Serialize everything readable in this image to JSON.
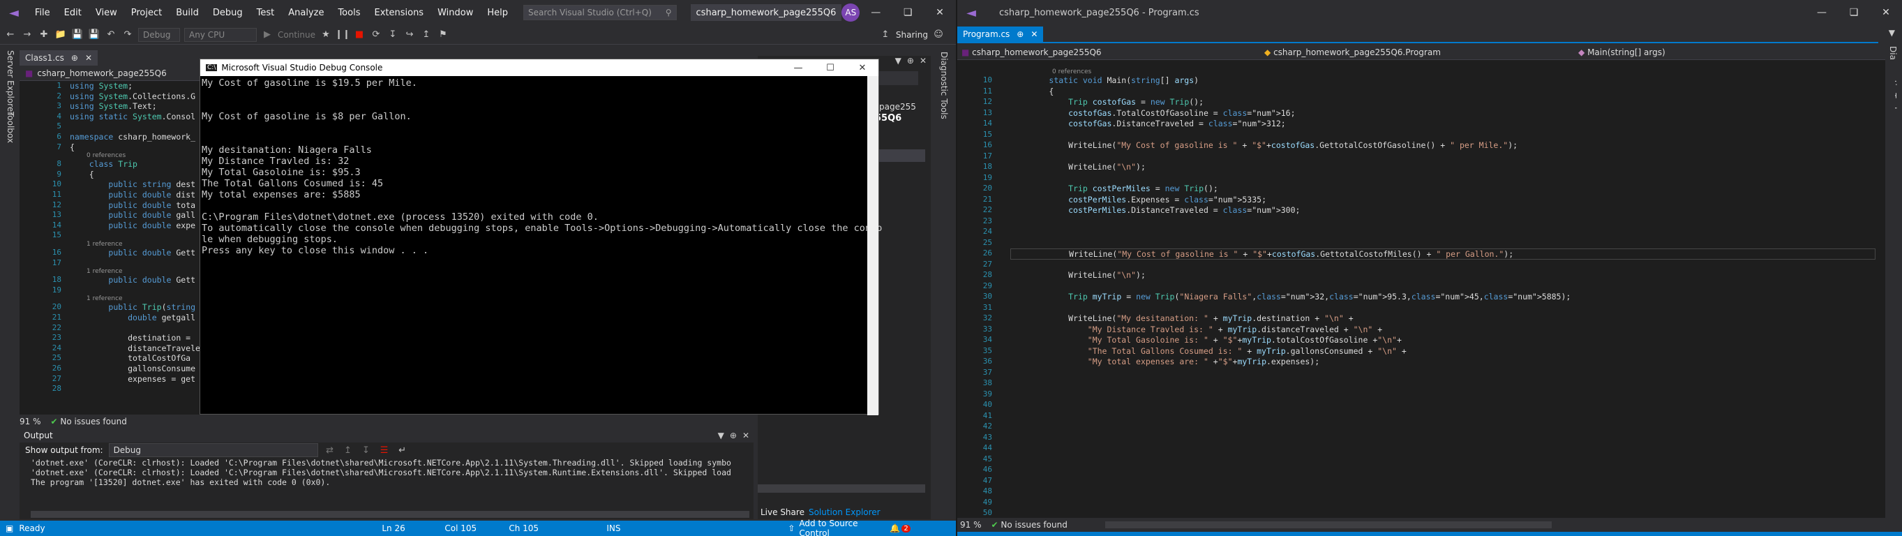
{
  "left": {
    "menu": [
      "File",
      "Edit",
      "View",
      "Project",
      "Build",
      "Debug",
      "Test",
      "Analyze",
      "Tools",
      "Extensions",
      "Window",
      "Help"
    ],
    "search_placeholder": "Search Visual Studio (Ctrl+Q)",
    "solution_title": "csharp_homework_page255Q6",
    "avatar": "AS",
    "sharing": "Sharing",
    "config": "Debug",
    "platform": "Any CPU",
    "continue": "Continue",
    "side_tabs": [
      "Server Explorer",
      "Toolbox"
    ],
    "right_side_tab": "Diagnostic Tools",
    "tab": "Class1.cs",
    "nav_project": "csharp_homework_page255Q6",
    "code": [
      {
        "n": "1",
        "t": "using System;"
      },
      {
        "n": "2",
        "t": "using System.Collections.G"
      },
      {
        "n": "3",
        "t": "using System.Text;"
      },
      {
        "n": "4",
        "t": "using static System.Consol"
      },
      {
        "n": "5",
        "t": ""
      },
      {
        "n": "6",
        "t": "namespace csharp_homework_"
      },
      {
        "n": "7",
        "t": "{"
      },
      {
        "n": "8",
        "t": "    class Trip",
        "ref": "0 references"
      },
      {
        "n": "9",
        "t": "    {"
      },
      {
        "n": "10",
        "t": "        public string dest"
      },
      {
        "n": "11",
        "t": "        public double dist"
      },
      {
        "n": "12",
        "t": "        public double tota"
      },
      {
        "n": "13",
        "t": "        public double gall"
      },
      {
        "n": "14",
        "t": "        public double expe"
      },
      {
        "n": "15",
        "t": ""
      },
      {
        "n": "16",
        "t": "        public double Gett",
        "ref": "1 reference"
      },
      {
        "n": "17",
        "t": ""
      },
      {
        "n": "18",
        "t": "        public double Gett",
        "ref": "1 reference"
      },
      {
        "n": "19",
        "t": ""
      },
      {
        "n": "20",
        "t": "        public Trip(string",
        "ref": "1 reference"
      },
      {
        "n": "21",
        "t": "            double getgall"
      },
      {
        "n": "22",
        "t": ""
      },
      {
        "n": "23",
        "t": "            destination ="
      },
      {
        "n": "24",
        "t": "            distanceTravele"
      },
      {
        "n": "25",
        "t": "            totalCostOfGa"
      },
      {
        "n": "26",
        "t": "            gallonsConsume"
      },
      {
        "n": "27",
        "t": "            expenses = get"
      },
      {
        "n": "28",
        "t": ""
      }
    ],
    "zoom": "91 %",
    "issues": "No issues found",
    "console": {
      "title": "Microsoft Visual Studio Debug Console",
      "lines": [
        "My Cost of gasoline is $19.5 per Mile.",
        "",
        "",
        "My Cost of gasoline is $8 per Gallon.",
        "",
        "",
        "My desitanation: Niagera Falls",
        "My Distance Travled is: 32",
        "My Total Gasoloine is: $95.3",
        "The Total Gallons Cosumed is: 45",
        "My total expenses are: $5885",
        "",
        "C:\\Program Files\\dotnet\\dotnet.exe (process 13520) exited with code 0.",
        "To automatically close the console when debugging stops, enable Tools->Options->Debugging->Automatically close the conso",
        "le when debugging stops.",
        "Press any key to close this window . . ."
      ]
    },
    "output": {
      "title": "Output",
      "show_from": "Show output from:",
      "source": "Debug",
      "lines": [
        "'dotnet.exe' (CoreCLR: clrhost): Loaded 'C:\\Program Files\\dotnet\\shared\\Microsoft.NETCore.App\\2.1.11\\System.Threading.dll'. Skipped loading symbo",
        "'dotnet.exe' (CoreCLR: clrhost): Loaded 'C:\\Program Files\\dotnet\\shared\\Microsoft.NETCore.App\\2.1.11\\System.Runtime.Extensions.dll'. Skipped load",
        "The program '[13520] dotnet.exe' has exited with code 0 (0x0)."
      ]
    },
    "solexp": {
      "partial1": "_page255",
      "partial2": "55Q6",
      "tab_live": "Live Share",
      "tab_sol": "Solution Explorer"
    },
    "status": {
      "ready": "Ready",
      "ln": "Ln 26",
      "col": "Col 105",
      "ch": "Ch 105",
      "ins": "INS",
      "add_source": "Add to Source Control",
      "notif": "2"
    }
  },
  "right": {
    "title": "csharp_homework_page255Q6 - Program.cs",
    "tab": "Program.cs",
    "nav_project": "csharp_homework_page255Q6",
    "nav_class": "csharp_homework_page255Q6.Program",
    "nav_member": "Main(string[] args)",
    "right_side_tab": "Diagnostic Tools",
    "refs": "0 references",
    "code": [
      {
        "n": "10",
        "t": "        static void Main(string[] args)"
      },
      {
        "n": "11",
        "t": "        {"
      },
      {
        "n": "12",
        "t": "            Trip costofGas = new Trip();"
      },
      {
        "n": "13",
        "t": "            costofGas.TotalCostOfGasoline = 16;"
      },
      {
        "n": "14",
        "t": "            costofGas.DistanceTraveled = 312;"
      },
      {
        "n": "15",
        "t": ""
      },
      {
        "n": "16",
        "t": "            WriteLine(\"My Cost of gasoline is \" + \"$\"+costofGas.GettotalCostOfGasoline() + \" per Mile.\");"
      },
      {
        "n": "17",
        "t": ""
      },
      {
        "n": "18",
        "t": "            WriteLine(\"\\n\");"
      },
      {
        "n": "19",
        "t": ""
      },
      {
        "n": "20",
        "t": "            Trip costPerMiles = new Trip();"
      },
      {
        "n": "21",
        "t": "            costPerMiles.Expenses = 5335;"
      },
      {
        "n": "22",
        "t": "            costPerMiles.DistanceTraveled = 300;"
      },
      {
        "n": "23",
        "t": ""
      },
      {
        "n": "24",
        "t": ""
      },
      {
        "n": "25",
        "t": ""
      },
      {
        "n": "26",
        "t": "            WriteLine(\"My Cost of gasoline is \" + \"$\"+costofGas.GettotalCostofMiles() + \" per Gallon.\");"
      },
      {
        "n": "27",
        "t": ""
      },
      {
        "n": "28",
        "t": "            WriteLine(\"\\n\");"
      },
      {
        "n": "29",
        "t": ""
      },
      {
        "n": "30",
        "t": "            Trip myTrip = new Trip(\"Niagera Falls\",32,95.3,45,5885);"
      },
      {
        "n": "31",
        "t": ""
      },
      {
        "n": "32",
        "t": "            WriteLine(\"My desitanation: \" + myTrip.destination + \"\\n\" +"
      },
      {
        "n": "33",
        "t": "                \"My Distance Travled is: \" + myTrip.distanceTraveled + \"\\n\" +"
      },
      {
        "n": "34",
        "t": "                \"My Total Gasoloine is: \" + \"$\"+myTrip.totalCostOfGasoline +\"\\n\"+"
      },
      {
        "n": "35",
        "t": "                \"The Total Gallons Cosumed is: \" + myTrip.gallonsConsumed + \"\\n\" +"
      },
      {
        "n": "36",
        "t": "                \"My total expenses are: \" +\"$\"+myTrip.expenses);"
      },
      {
        "n": "37",
        "t": ""
      },
      {
        "n": "38",
        "t": ""
      },
      {
        "n": "39",
        "t": ""
      },
      {
        "n": "40",
        "t": ""
      },
      {
        "n": "41",
        "t": ""
      },
      {
        "n": "42",
        "t": ""
      },
      {
        "n": "43",
        "t": ""
      },
      {
        "n": "44",
        "t": ""
      },
      {
        "n": "45",
        "t": ""
      },
      {
        "n": "46",
        "t": ""
      },
      {
        "n": "47",
        "t": ""
      },
      {
        "n": "48",
        "t": ""
      },
      {
        "n": "49",
        "t": ""
      },
      {
        "n": "50",
        "t": ""
      }
    ],
    "zoom": "91 %",
    "issues": "No issues found"
  },
  "colors": {
    "accent": "#007acc",
    "bg": "#1e1e1e",
    "chrome": "#2d2d30"
  }
}
